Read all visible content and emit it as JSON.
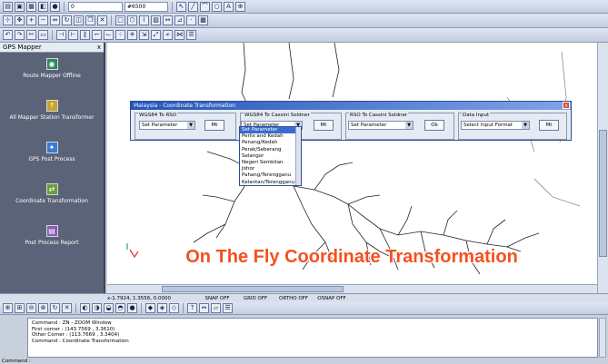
{
  "toolbar1": {
    "combo_layer": "0",
    "combo_scale": "#6500",
    "icons": [
      "open-icon",
      "save-icon",
      "print-icon",
      "layer-icon",
      "color-icon",
      "pointer-icon",
      "line-icon",
      "arc-icon",
      "circle-icon",
      "text-icon"
    ]
  },
  "left_panel": {
    "title": "GPS Mapper",
    "close": "x",
    "tools": [
      {
        "label": "Route Mapper Offline"
      },
      {
        "label": "All Mapper Station Transformer"
      },
      {
        "label": "GPS Post Process"
      },
      {
        "label": "Coordinate Transformation"
      },
      {
        "label": "Post Process Report"
      }
    ]
  },
  "dialog": {
    "title": "Malaysia - Coordinate Transformation",
    "close": "x",
    "groups": [
      {
        "label": "WGS84 To RSO",
        "select": "Set Parameter",
        "button": "Mt"
      },
      {
        "label": "WGS84 To Cassini Soldner",
        "select": "Set Parameter",
        "button": "Mt"
      },
      {
        "label": "RSO To Cassini Soldner",
        "select": "Set Parameter",
        "button": "Ok"
      },
      {
        "label": "Data Input",
        "select": "Select Input Format",
        "button": "Mt"
      }
    ],
    "dropdown_options": [
      "Perlis and Kedah",
      "Penang/Kedah",
      "Perak/Seberang",
      "Selangor",
      "Negeri Sembilan",
      "Johor",
      "Pahang/Terengganu",
      "Kelantan/Terengganu"
    ],
    "dropdown_selected": "Set Parameter"
  },
  "overlay_title": "On The Fly Coordinate Transformation",
  "statusbar": {
    "coord": "x-1.7924, 1.3556, 0.0000",
    "toggles": [
      "SNAP OFF",
      "GRID OFF",
      "ORTHO OFF",
      "OSNAP OFF"
    ]
  },
  "command": {
    "lines": [
      "Command : ZN - ZOOM Window",
      "First corner : (143.7569 , 3.3610)",
      "Other Corner : (113.7669 , 3.3404)",
      "Command : Coordinate Transformation"
    ],
    "prompt": "Command :"
  }
}
